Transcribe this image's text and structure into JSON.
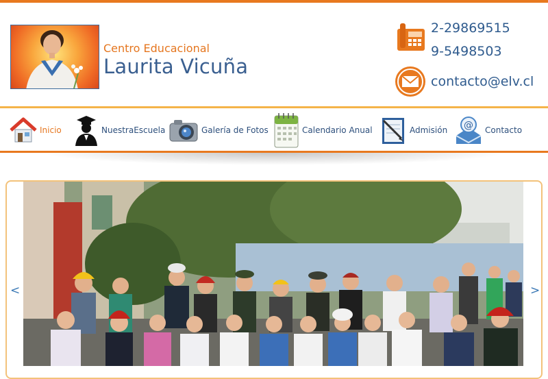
{
  "header": {
    "brand_small": "Centro Educacional",
    "brand_big": "Laurita Vicuña",
    "phone_1": "2-29869515",
    "phone_2": "9-5498503",
    "email": "contacto@elv.cl"
  },
  "nav": {
    "items": [
      {
        "label": "Inicio",
        "icon": "house-icon",
        "active": true
      },
      {
        "label": "NuestraEscuela",
        "icon": "graduate-icon"
      },
      {
        "label": "Galería de Fotos",
        "icon": "camera-icon"
      },
      {
        "label": "Calendario Anual",
        "icon": "calendar-icon"
      },
      {
        "label": "Admisión",
        "icon": "document-pen-icon"
      },
      {
        "label": "Contacto",
        "icon": "email-at-icon"
      }
    ]
  },
  "slider": {
    "prev": "<",
    "next": ">"
  },
  "colors": {
    "accent_orange": "#e8791f",
    "brand_blue": "#3a5f90",
    "border_light_orange": "#f3c27a"
  }
}
